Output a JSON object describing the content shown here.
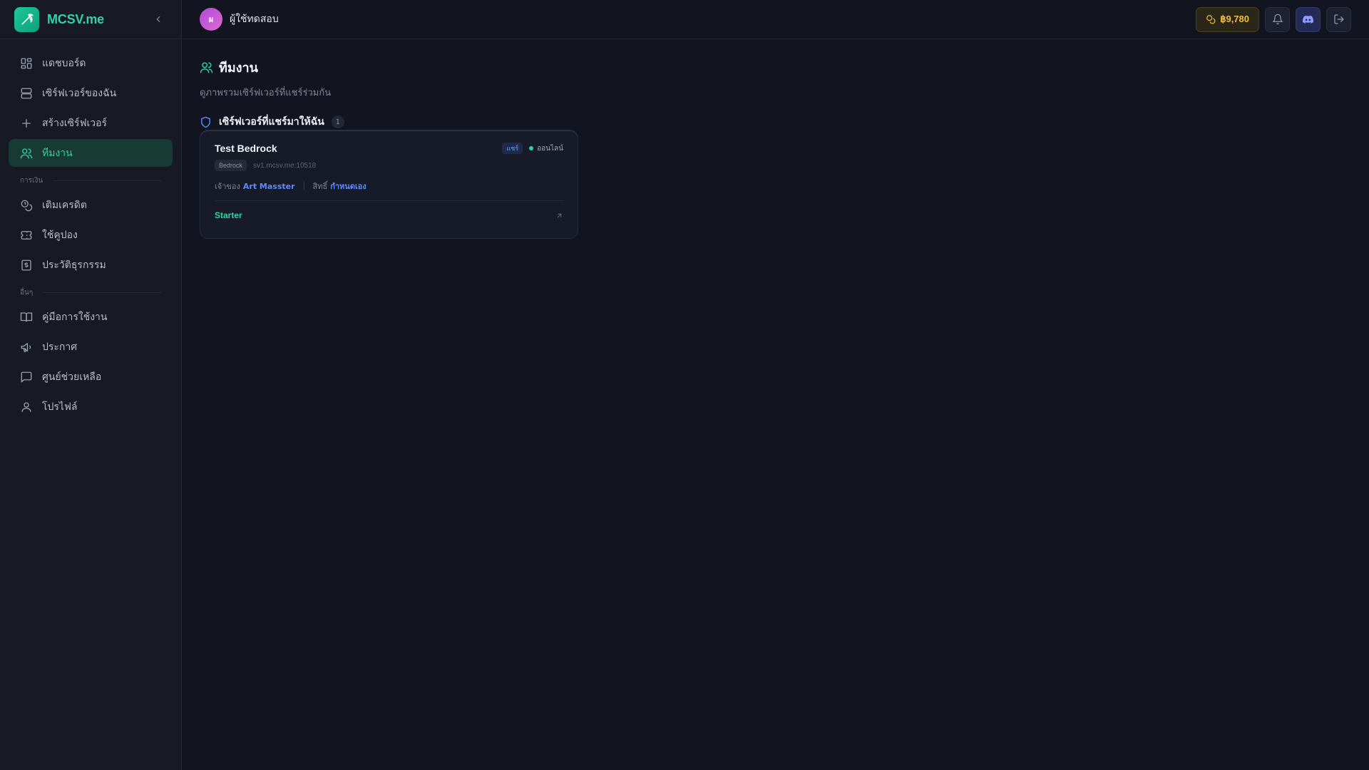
{
  "brand": {
    "name": "MCSV.me",
    "logo_icon": "pickaxe-icon"
  },
  "header": {
    "user_initial": "ผ",
    "username": "ผู้ใช้ทดสอบ",
    "credit": "฿9,780",
    "buttons": [
      "bell-icon",
      "discord-icon",
      "logout-icon"
    ]
  },
  "sidebar": {
    "main_items": [
      {
        "label": "แดชบอร์ด",
        "icon": "dashboard-icon"
      },
      {
        "label": "เซิร์ฟเวอร์ของฉัน",
        "icon": "server-icon"
      },
      {
        "label": "สร้างเซิร์ฟเวอร์",
        "icon": "plus-icon"
      },
      {
        "label": "ทีมงาน",
        "icon": "users-icon",
        "active": true
      }
    ],
    "finance_label": "การเงิน",
    "finance_items": [
      {
        "label": "เติมเครดิต",
        "icon": "coins-icon"
      },
      {
        "label": "ใช้คูปอง",
        "icon": "ticket-icon"
      },
      {
        "label": "ประวัติธุรกรรม",
        "icon": "receipt-icon"
      }
    ],
    "other_label": "อื่นๆ",
    "other_items": [
      {
        "label": "คู่มือการใช้งาน",
        "icon": "book-icon"
      },
      {
        "label": "ประกาศ",
        "icon": "megaphone-icon"
      },
      {
        "label": "ศูนย์ช่วยเหลือ",
        "icon": "message-icon"
      },
      {
        "label": "โปรไฟล์",
        "icon": "user-icon"
      }
    ]
  },
  "page": {
    "title": "ทีมงาน",
    "subtitle": "ดูภาพรวมเซิร์ฟเวอร์ที่แชร์ร่วมกัน",
    "section_title": "เซิร์ฟเวอร์ที่แชร์มาให้ฉัน",
    "section_count": "1"
  },
  "server_card": {
    "name": "Test Bedrock",
    "share_badge": "แชร์",
    "status": "ออนไลน์",
    "edition": "Bedrock",
    "address": "sv1.mcsv.me:10518",
    "owner_label": "เจ้าของ",
    "owner_name": "Art Masster",
    "permission_label": "สิทธิ์",
    "permission_value": "กำหนดเอง",
    "plan": "Starter"
  },
  "colors": {
    "accent": "#2fd3a4",
    "link": "#5b8cff",
    "credit": "#f2be3d",
    "background": "#121420",
    "sidebar": "#171923"
  }
}
